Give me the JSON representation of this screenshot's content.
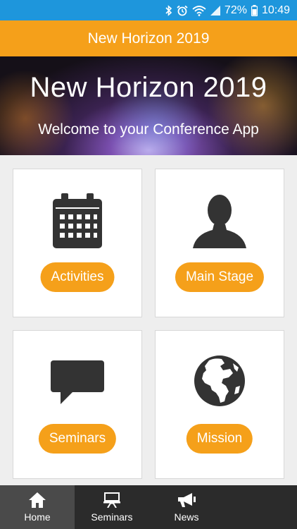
{
  "status_bar": {
    "battery": "72%",
    "time": "10:49"
  },
  "app_bar": {
    "title": "New Horizon 2019"
  },
  "hero": {
    "title": "New Horizon 2019",
    "subtitle": "Welcome to your Conference App"
  },
  "tiles": [
    {
      "label": "Activities",
      "icon": "calendar-icon"
    },
    {
      "label": "Main Stage",
      "icon": "person-icon"
    },
    {
      "label": "Seminars",
      "icon": "speech-bubble-icon"
    },
    {
      "label": "Mission",
      "icon": "globe-icon"
    }
  ],
  "bottom_nav": {
    "items": [
      {
        "label": "Home",
        "icon": "home-icon",
        "active": true
      },
      {
        "label": "Seminars",
        "icon": "presentation-icon"
      },
      {
        "label": "News",
        "icon": "megaphone-icon"
      }
    ]
  },
  "colors": {
    "accent": "#f5a01a",
    "status_bar": "#1e96dc",
    "nav_bg": "#2b2b2b",
    "nav_active": "#4a4a4a",
    "icon": "#333333"
  }
}
